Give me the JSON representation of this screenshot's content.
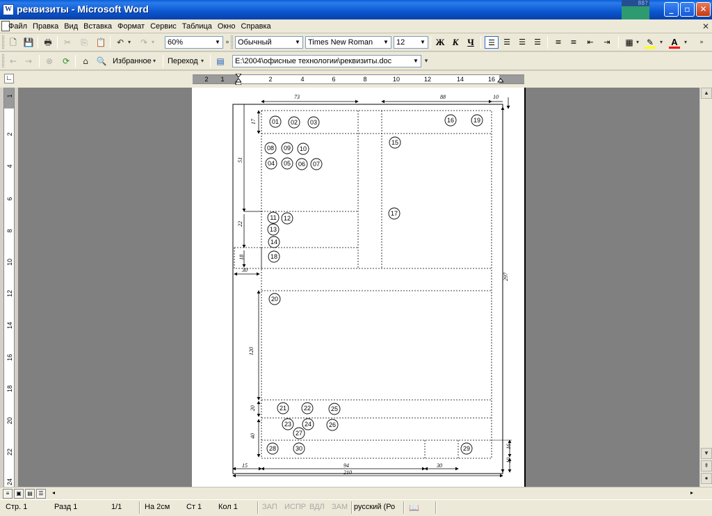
{
  "window": {
    "title": "реквизиты - Microsoft Word",
    "tray_meter": "88?",
    "buttons": {
      "minimize": "_",
      "restore": "▫",
      "close": "✕"
    }
  },
  "menu": {
    "items": [
      "Файл",
      "Правка",
      "Вид",
      "Вставка",
      "Формат",
      "Сервис",
      "Таблица",
      "Окно",
      "Справка"
    ]
  },
  "toolbar": {
    "zoom": "60%",
    "style": "Обычный",
    "font": "Times New Roman",
    "font_size": "12",
    "bold": "Ж",
    "italic": "К",
    "underline": "Ч",
    "highlight_color": "#ffff00",
    "font_color": "#ff0000"
  },
  "web_toolbar": {
    "favorites": "Избранное",
    "go": "Переход",
    "address": "E:\\2004\\офисные технологии\\реквизиты.doc"
  },
  "ruler": {
    "h_ticks": [
      "2",
      "1",
      "2",
      "4",
      "6",
      "8",
      "10",
      "12",
      "14",
      "16"
    ],
    "v_ticks": [
      "1",
      "2",
      "4",
      "6",
      "8",
      "10",
      "12",
      "14",
      "16",
      "18",
      "20",
      "22",
      "24"
    ]
  },
  "form": {
    "dimensions": {
      "top_left_width": "73",
      "top_right_width": "88",
      "right_margin": "10",
      "h1": "17",
      "h2": "51",
      "h3": "22",
      "h4": "18",
      "left_margin": "30",
      "page_height": "297",
      "body_height": "120",
      "sig_height": "20",
      "bottom_height": "40",
      "right_small": "16",
      "right_bottom": "10",
      "bottom_left": "15",
      "bottom_mid": "94",
      "bottom_right": "30",
      "page_width": "210"
    },
    "labels": {
      "r01": "01",
      "r02": "02",
      "r03": "03",
      "r16": "16",
      "r19": "19",
      "r08": "08",
      "r09": "09",
      "r10": "10",
      "r15": "15",
      "r04": "04",
      "r05": "05",
      "r06": "06",
      "r07": "07",
      "r11": "11",
      "r12": "12",
      "r17": "17",
      "r13": "13",
      "r14": "14",
      "r18": "18",
      "r20": "20",
      "r21": "21",
      "r22": "22",
      "r25": "25",
      "r23": "23",
      "r24": "24",
      "r26": "26",
      "r27": "27",
      "r28": "28",
      "r30": "30",
      "r29": "29"
    }
  },
  "status": {
    "page": "Стр. 1",
    "section": "Разд 1",
    "pages": "1/1",
    "at": "На 2см",
    "line": "Ст 1",
    "col": "Кол 1",
    "rec": "ЗАП",
    "trk": "ИСПР",
    "ext": "ВДЛ",
    "ovr": "ЗАМ",
    "lang": "русский (Ро"
  }
}
